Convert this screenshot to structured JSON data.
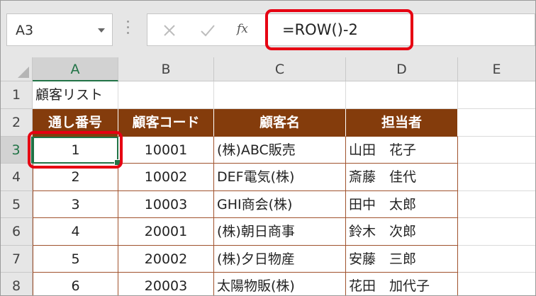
{
  "name_box": {
    "value": "A3"
  },
  "formula_bar": {
    "cancel_icon": "close-icon",
    "enter_icon": "check-icon",
    "function_icon": "fx-icon",
    "fx_label": "fx",
    "formula": "=ROW()-2"
  },
  "columns": [
    "A",
    "B",
    "C",
    "D",
    "E"
  ],
  "rows": [
    "1",
    "2",
    "3",
    "4",
    "5",
    "6",
    "7",
    "8"
  ],
  "selected": {
    "column": "A",
    "row": "3"
  },
  "sheet": {
    "title": "顧客リスト",
    "headers": [
      "通し番号",
      "顧客コード",
      "顧客名",
      "担当者"
    ],
    "records": [
      [
        "1",
        "10001",
        "(株)ABC販売",
        "山田　花子"
      ],
      [
        "2",
        "10002",
        "DEF電気(株)",
        "斎藤　佳代"
      ],
      [
        "3",
        "10003",
        "GHI商会(株)",
        "田中　太郎"
      ],
      [
        "4",
        "20001",
        "(株)朝日商事",
        "鈴木　次郎"
      ],
      [
        "5",
        "20002",
        "(株)夕日物産",
        "安藤　三郎"
      ],
      [
        "6",
        "20003",
        "太陽物販(株)",
        "花田　加代子"
      ]
    ]
  },
  "colors": {
    "header_fill": "#843c0c",
    "table_border": "#a0522d",
    "highlight_red": "#e60012",
    "excel_green": "#217346"
  }
}
